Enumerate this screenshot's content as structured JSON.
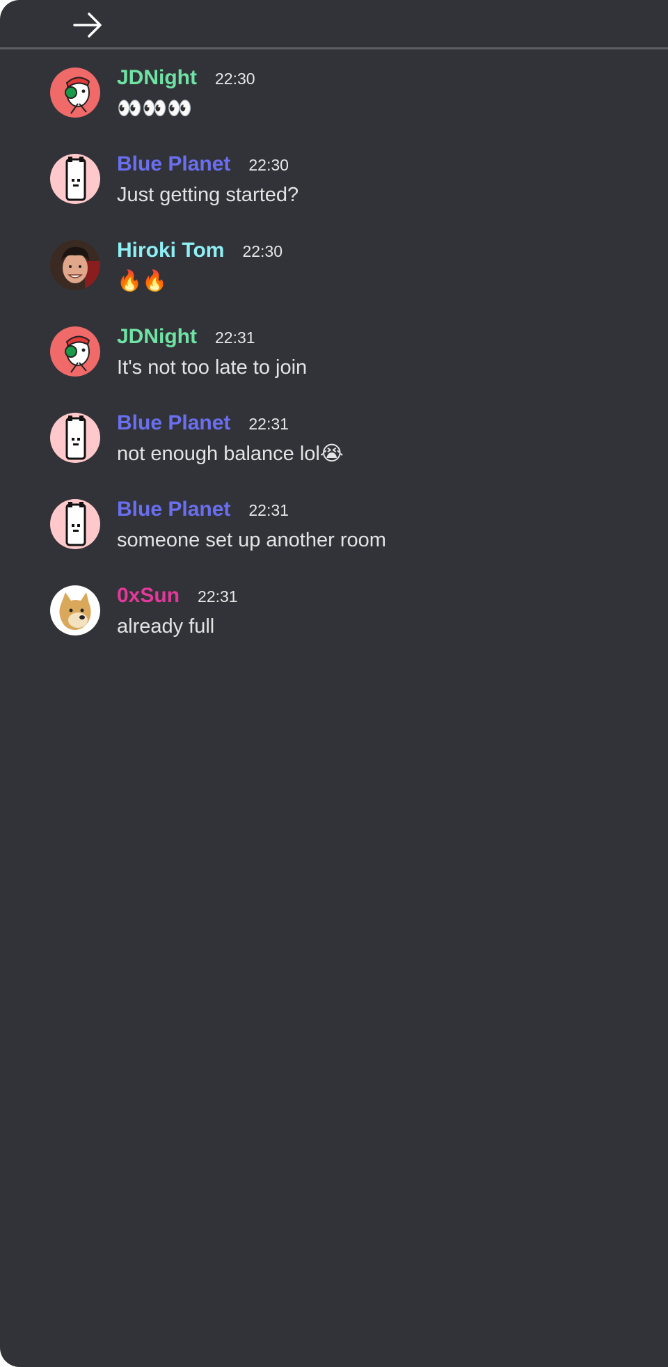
{
  "header": {
    "collapse_icon": "arrow-right-icon"
  },
  "messages": [
    {
      "author": "JDNight",
      "time": "22:30",
      "text": "👀👀👀",
      "author_color": "#6fe3a4",
      "avatar": "jdnight-avatar"
    },
    {
      "author": "Blue Planet",
      "time": "22:30",
      "text": "Just getting started?",
      "author_color": "#6a6ff0",
      "avatar": "blue-planet-avatar"
    },
    {
      "author": "Hiroki Tom",
      "time": "22:30",
      "text": "🔥🔥",
      "author_color": "#8ef0f5",
      "avatar": "hiroki-tom-avatar"
    },
    {
      "author": "JDNight",
      "time": "22:31",
      "text": "It's not too late to join",
      "author_color": "#6fe3a4",
      "avatar": "jdnight-avatar"
    },
    {
      "author": "Blue Planet",
      "time": "22:31",
      "text": "not enough balance lol😭",
      "author_color": "#6a6ff0",
      "avatar": "blue-planet-avatar"
    },
    {
      "author": "Blue Planet",
      "time": "22:31",
      "text": "someone set up another room",
      "author_color": "#6a6ff0",
      "avatar": "blue-planet-avatar"
    },
    {
      "author": "0xSun",
      "time": "22:31",
      "text": "already full",
      "author_color": "#e2399a",
      "avatar": "doge-avatar"
    }
  ],
  "colors": {
    "background": "#323338",
    "divider": "#5e5f62",
    "text": "#e4e4e6"
  }
}
